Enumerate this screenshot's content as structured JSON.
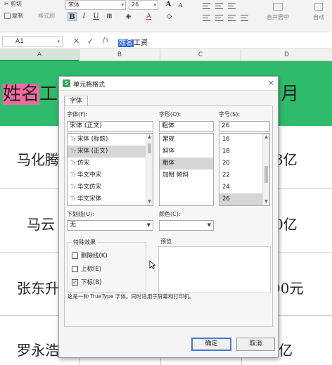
{
  "ribbon": {
    "cut_label": "剪切",
    "copy_label": "复制",
    "format_painter_label": "格式刷",
    "font_name": "宋体",
    "font_size": "26",
    "merge_center_label": "合并居中",
    "wrap_label": "自动"
  },
  "formula_bar": {
    "cell_ref": "A1",
    "fx_label": "fx",
    "content_selected": "姓名",
    "content_rest": "工资"
  },
  "columns": [
    {
      "label": "A"
    },
    {
      "label": "B"
    },
    {
      "label": "C"
    },
    {
      "label": "D"
    }
  ],
  "sheet": {
    "header_row": {
      "a_highlight": "姓名",
      "a_rest": "工",
      "d_partial": "月"
    },
    "rows": [
      {
        "name": "马化腾",
        "d": "3亿"
      },
      {
        "name": "马云",
        "d": "0亿"
      },
      {
        "name": "张东升",
        "d": "00元"
      },
      {
        "name": "罗永浩",
        "d": "亿"
      }
    ]
  },
  "dialog": {
    "title": "单元格格式",
    "tab_font": "字体",
    "font_label": "字体(F):",
    "font_value": "宋体 (正文)",
    "font_list": [
      {
        "label": "宋体 (标题)",
        "selected": false
      },
      {
        "label": "宋体 (正文)",
        "selected": true
      },
      {
        "label": "仿宋",
        "selected": false
      },
      {
        "label": "华文中宋",
        "selected": false
      },
      {
        "label": "华文仿宋",
        "selected": false
      },
      {
        "label": "华文宋体",
        "selected": false
      }
    ],
    "style_label": "字形(O):",
    "style_value": "粗体",
    "style_list": [
      {
        "label": "常规",
        "selected": false
      },
      {
        "label": "斜体",
        "selected": false
      },
      {
        "label": "粗体",
        "selected": true
      },
      {
        "label": "加粗 倾斜",
        "selected": false
      }
    ],
    "size_label": "字号(S):",
    "size_value": "26",
    "size_list": [
      {
        "label": "16",
        "selected": false
      },
      {
        "label": "18",
        "selected": false
      },
      {
        "label": "20",
        "selected": false
      },
      {
        "label": "22",
        "selected": false
      },
      {
        "label": "24",
        "selected": false
      },
      {
        "label": "26",
        "selected": true
      }
    ],
    "underline_label": "下划线(U):",
    "underline_value": "无",
    "color_label": "颜色(C):",
    "effects_label": "特殊效果",
    "strikethrough_label": "删除线(K)",
    "strikethrough_checked": false,
    "superscript_label": "上标(E)",
    "superscript_checked": false,
    "subscript_label": "下标(B)",
    "subscript_checked": true,
    "check_mark": "✓",
    "preview_label": "预览",
    "note": "这是一种 TrueType 字体。同时适用于屏幕和打印机。",
    "ok_label": "确定",
    "cancel_label": "取消",
    "close_symbol": "×"
  },
  "icons": {
    "tt_glyph": "Tr",
    "check": "✓",
    "x": "✕",
    "dropdown": "▾",
    "scroll_up": "▲",
    "scroll_down": "▼"
  }
}
